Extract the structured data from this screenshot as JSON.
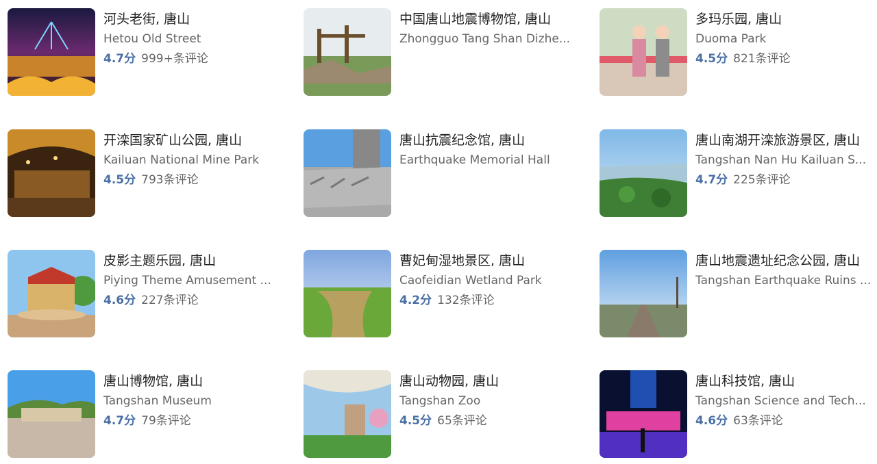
{
  "attractions": [
    {
      "title": "河头老街, 唐山",
      "subtitle": "Hetou Old Street",
      "score": "4.7分",
      "reviews": "999+条评论"
    },
    {
      "title": "中国唐山地震博物馆, 唐山",
      "subtitle": "Zhongguo Tang Shan Dizhe...",
      "score": "",
      "reviews": ""
    },
    {
      "title": "多玛乐园, 唐山",
      "subtitle": "Duoma Park",
      "score": "4.5分",
      "reviews": "821条评论"
    },
    {
      "title": "开滦国家矿山公园, 唐山",
      "subtitle": "Kailuan National Mine Park",
      "score": "4.5分",
      "reviews": "793条评论"
    },
    {
      "title": "唐山抗震纪念馆, 唐山",
      "subtitle": "Earthquake Memorial Hall",
      "score": "",
      "reviews": ""
    },
    {
      "title": "唐山南湖开滦旅游景区, 唐山",
      "subtitle": "Tangshan Nan Hu Kailuan S...",
      "score": "4.7分",
      "reviews": "225条评论"
    },
    {
      "title": "皮影主题乐园, 唐山",
      "subtitle": "Piying Theme Amusement ...",
      "score": "4.6分",
      "reviews": "227条评论"
    },
    {
      "title": "曹妃甸湿地景区, 唐山",
      "subtitle": "Caofeidian Wetland Park",
      "score": "4.2分",
      "reviews": "132条评论"
    },
    {
      "title": "唐山地震遗址纪念公园, 唐山",
      "subtitle": "Tangshan Earthquake Ruins ...",
      "score": "",
      "reviews": ""
    },
    {
      "title": "唐山博物馆, 唐山",
      "subtitle": "Tangshan Museum",
      "score": "4.7分",
      "reviews": "79条评论"
    },
    {
      "title": "唐山动物园, 唐山",
      "subtitle": "Tangshan Zoo",
      "score": "4.5分",
      "reviews": "65条评论"
    },
    {
      "title": "唐山科技馆, 唐山",
      "subtitle": "Tangshan Science and Tech...",
      "score": "4.6分",
      "reviews": "63条评论"
    }
  ],
  "colors": {
    "score": "#4a6fa5",
    "title": "#222222",
    "secondary": "#666666"
  }
}
